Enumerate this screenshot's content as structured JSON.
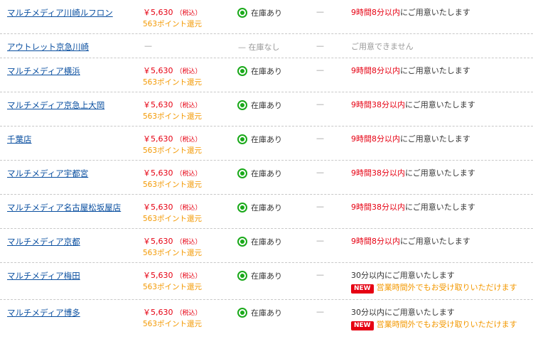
{
  "rows": [
    {
      "store": "マルチメディア川崎ルフロン",
      "price": "￥5,630",
      "tax": "（税込）",
      "points": "563ポイント還元",
      "stock": "在庫あり",
      "dash": "—",
      "delivery_red": "9時間8分以内",
      "delivery_rest": "にご用意いたします"
    },
    {
      "store": "アウトレット京急川崎",
      "price_dash": "—",
      "stock_dash": "—",
      "stock": "在庫なし",
      "dash": "—",
      "delivery_gray": "ご用意できません"
    },
    {
      "store": "マルチメディア横浜",
      "price": "￥5,630",
      "tax": "（税込）",
      "points": "563ポイント還元",
      "stock": "在庫あり",
      "dash": "—",
      "delivery_red": "9時間8分以内",
      "delivery_rest": "にご用意いたします"
    },
    {
      "store": "マルチメディア京急上大岡",
      "price": "￥5,630",
      "tax": "（税込）",
      "points": "563ポイント還元",
      "stock": "在庫あり",
      "dash": "—",
      "delivery_red": "9時間38分以内",
      "delivery_rest": "にご用意いたします"
    },
    {
      "store": "千葉店",
      "price": "￥5,630",
      "tax": "（税込）",
      "points": "563ポイント還元",
      "stock": "在庫あり",
      "dash": "—",
      "delivery_red": "9時間8分以内",
      "delivery_rest": "にご用意いたします"
    },
    {
      "store": "マルチメディア宇都宮",
      "price": "￥5,630",
      "tax": "（税込）",
      "points": "563ポイント還元",
      "stock": "在庫あり",
      "dash": "—",
      "delivery_red": "9時間38分以内",
      "delivery_rest": "にご用意いたします"
    },
    {
      "store": "マルチメディア名古屋松坂屋店",
      "price": "￥5,630",
      "tax": "（税込）",
      "points": "563ポイント還元",
      "stock": "在庫あり",
      "dash": "—",
      "delivery_red": "9時間38分以内",
      "delivery_rest": "にご用意いたします"
    },
    {
      "store": "マルチメディア京都",
      "price": "￥5,630",
      "tax": "（税込）",
      "points": "563ポイント還元",
      "stock": "在庫あり",
      "dash": "—",
      "delivery_red": "9時間8分以内",
      "delivery_rest": "にご用意いたします"
    },
    {
      "store": "マルチメディア梅田",
      "price": "￥5,630",
      "tax": "（税込）",
      "points": "563ポイント還元",
      "stock": "在庫あり",
      "dash": "—",
      "delivery_dark": "30分以内にご用意いたします",
      "new_badge": "NEW",
      "new_text": "営業時間外でもお受け取りいただけます"
    },
    {
      "store": "マルチメディア博多",
      "price": "￥5,630",
      "tax": "（税込）",
      "points": "563ポイント還元",
      "stock": "在庫あり",
      "dash": "—",
      "delivery_dark": "30分以内にご用意いたします",
      "new_badge": "NEW",
      "new_text": "営業時間外でもお受け取りいただけます"
    }
  ],
  "colors": {
    "link": "#0a4fa0",
    "price": "#e60012",
    "points": "#f39800",
    "stock_ok": "#1aa91a"
  },
  "icons": {
    "stock_ok": "circle-check-icon"
  }
}
